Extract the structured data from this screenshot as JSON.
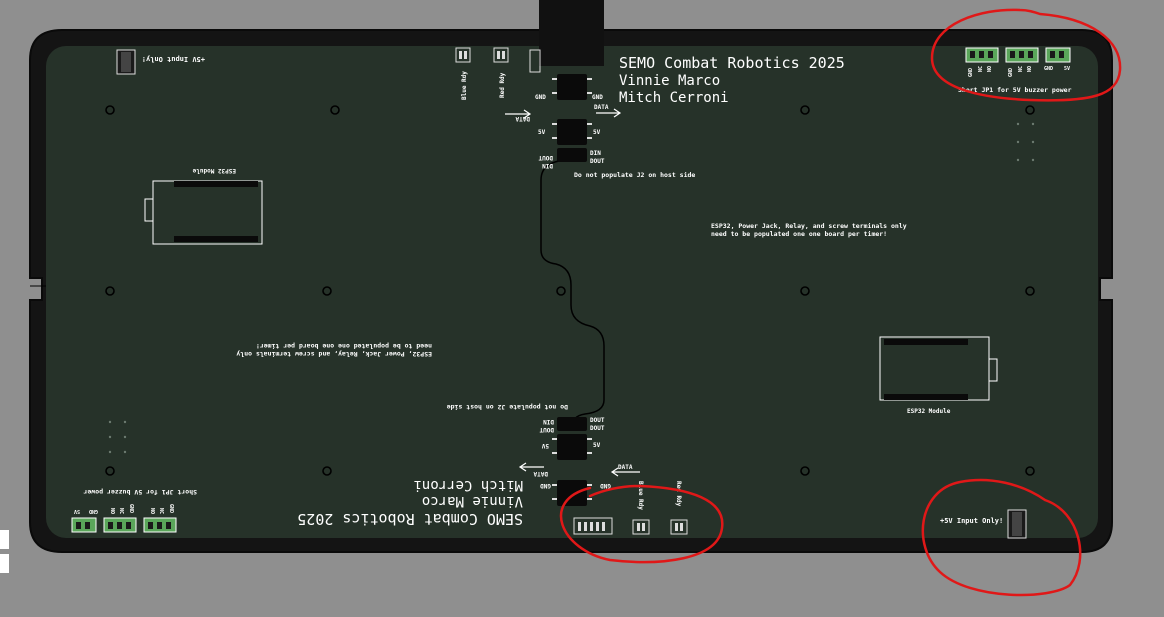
{
  "board": {
    "title_top": "SEMO Combat Robotics 2025",
    "author1_top": "Vinnie Marco",
    "author2_top": "Mitch Cerroni",
    "title_bottom": "SEMO Combat Robotics 2025",
    "author1_bottom": "Vinnie Marco",
    "author2_bottom": "Mitch Cerroni"
  },
  "silkscreen": {
    "blue_rdy": "Blue Rdy",
    "red_rdy": "Red Rdy",
    "gnd": "GND",
    "data": "DATA",
    "v5": "5V",
    "dout": "DOUT",
    "din": "DIN",
    "no_j2": "Do not populate J2 on host side",
    "esp32_note_line1": "ESP32, Power Jack, Relay, and screw terminals only",
    "esp32_note_line2": "need to be populated one one board per timer!",
    "esp32_module": "ESP32 Module",
    "v5_input_only": "+5V Input Only!",
    "short_jp1": "Short JP1 for 5V buzzer power",
    "terminal_gnd": "GND",
    "terminal_nc": "NC",
    "terminal_no": "NO",
    "terminal_5v": "5V",
    "terminal_sig": "SIG"
  }
}
